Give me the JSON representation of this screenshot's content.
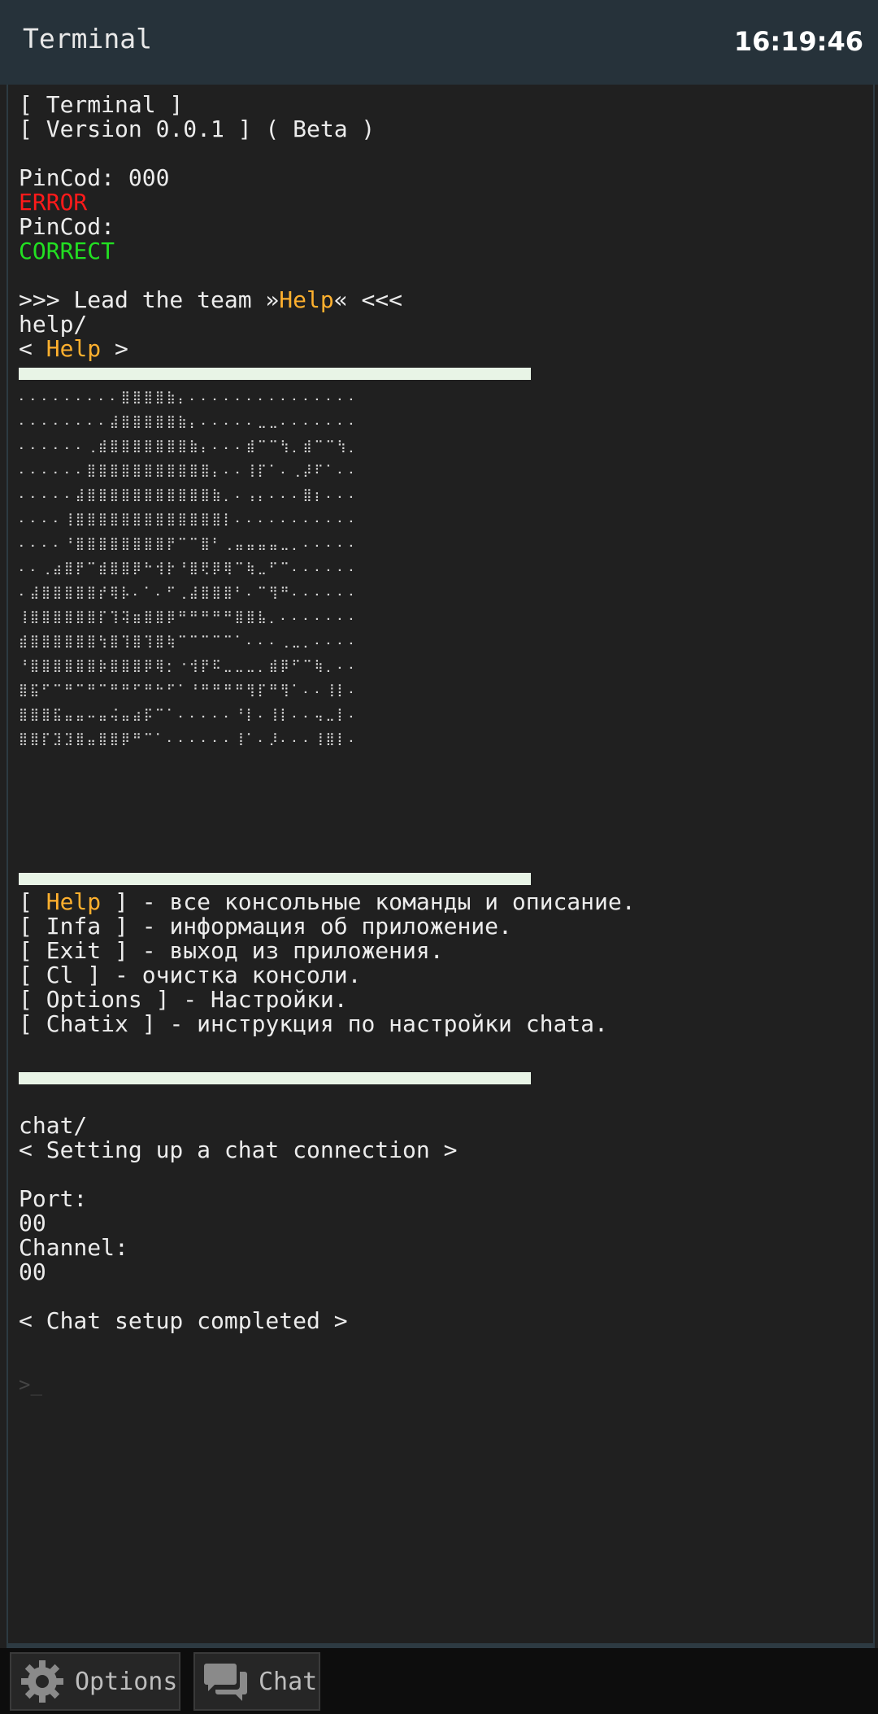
{
  "header": {
    "title": "Terminal",
    "clock": "16:19:46"
  },
  "terminal": {
    "line1": "[ Terminal ]",
    "line2": "[ Version 0.0.1 ] ( Beta )",
    "pin1_label": "PinCod: 000",
    "pin1_status": "ERROR",
    "pin2_label": "PinCod:",
    "pin2_status": "CORRECT",
    "lead_prefix": ">>> Lead the team »",
    "lead_cmd": "Help",
    "lead_suffix": "« <<<",
    "help_cmd": "help/",
    "help_title_prefix": "< ",
    "help_title": "Help",
    "help_title_suffix": " >",
    "commands": [
      {
        "name": "Help",
        "text": " ] - все консольные команды и описание."
      },
      {
        "name": "Infa",
        "text": " ] - информация об приложение."
      },
      {
        "name": "Exit",
        "text": " ] - выход из приложения."
      },
      {
        "name": "Cl",
        "text": " ] - очистка консоли."
      },
      {
        "name": "Options",
        "text": " ] - Настройки."
      },
      {
        "name": "Chatix",
        "text": " ] - инструкция по настройки chata."
      }
    ],
    "chat_cmd": "chat/",
    "chat_title": "< Setting up a chat connection >",
    "port_label": "Port:",
    "port_value": "00",
    "channel_label": "Channel:",
    "channel_value": "00",
    "chat_done": "< Chat setup completed >",
    "prompt": ">_"
  },
  "bottom_nav": {
    "options_label": "Options",
    "options_icon": "gear-icon",
    "chat_label": "Chat",
    "chat_icon": "chat-bubbles-icon"
  },
  "colors": {
    "error": "#ff1a1a",
    "correct": "#22e022",
    "highlight": "#ffb02e",
    "background": "#202020",
    "header": "#26323a"
  }
}
